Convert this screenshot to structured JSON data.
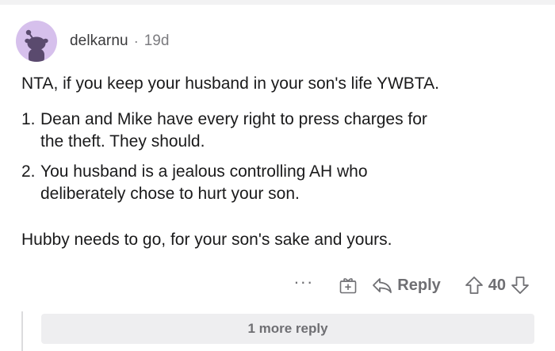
{
  "comment": {
    "author": "delkarnu",
    "separator": "·",
    "age": "19d",
    "intro": "NTA, if you keep your husband in your son's life YWBTA.",
    "points": [
      {
        "number": "1.",
        "line1": "Dean and Mike have every right to press charges for",
        "line2": "the theft. They should."
      },
      {
        "number": "2.",
        "line1": "You husband is a jealous controlling AH who",
        "line2": "deliberately chose to hurt your son."
      }
    ],
    "closing": "Hubby needs to go, for your son's sake and yours."
  },
  "actions": {
    "more_label": "···",
    "award_icon": "gift-plus-icon",
    "reply_label": "Reply",
    "reply_icon": "reply-arrow-icon",
    "upvote_icon": "upvote-arrow-icon",
    "score": "40",
    "downvote_icon": "downvote-arrow-icon"
  },
  "replies": {
    "more_label": "1 more reply"
  },
  "colors": {
    "avatar_bg": "#d6c0ec",
    "avatar_figure": "#5a4a6e",
    "muted_text": "#6f6f73"
  }
}
